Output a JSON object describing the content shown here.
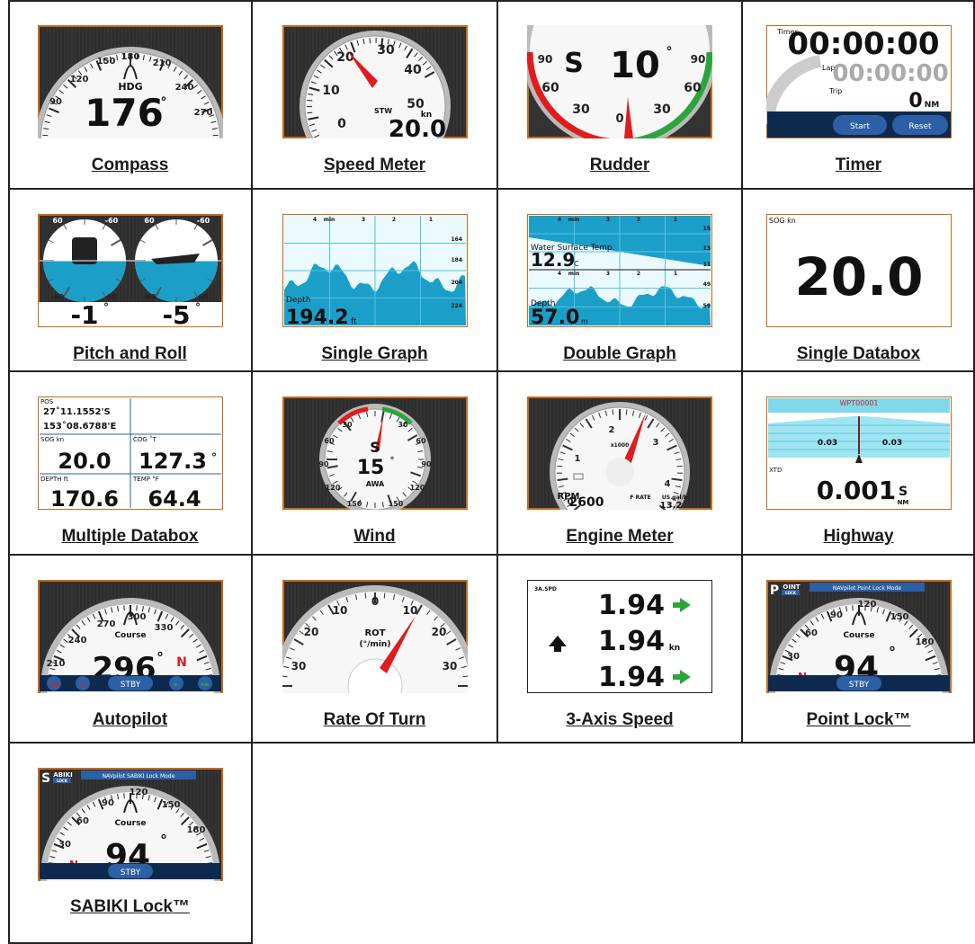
{
  "captions": [
    "Compass",
    "Speed Meter",
    "Rudder",
    "Timer",
    "Pitch and Roll",
    "Single Graph",
    "Double Graph",
    "Single Databox",
    "Multiple Databox",
    "Wind",
    "Engine Meter",
    "Highway",
    "Autopilot",
    "Rate Of Turn",
    "3-Axis Speed",
    "Point Lock™",
    "SABIKI Lock™"
  ],
  "compass": {
    "label": "HDG",
    "value": "176",
    "unit": "°",
    "ticks": [
      "90",
      "120",
      "150",
      "180",
      "210",
      "240",
      "270"
    ]
  },
  "speed": {
    "label": "STW",
    "value": "20.0",
    "unit": "kn",
    "ticks": [
      "0",
      "10",
      "20",
      "30",
      "40",
      "50"
    ]
  },
  "rudder": {
    "side": "S",
    "value": "10",
    "unit": "°",
    "ticks_left": [
      "90",
      "60",
      "30"
    ],
    "ticks_right": [
      "90",
      "60",
      "30"
    ],
    "center": "0"
  },
  "timer": {
    "title": "Timer",
    "time": "00:00:00",
    "lap_label": "Lap",
    "lap": "00:00:00",
    "trip_label": "Trip",
    "trip": "0",
    "trip_unit": "NM",
    "start": "Start",
    "reset": "Reset"
  },
  "pitch_roll": {
    "pitch": "-1",
    "roll": "-5",
    "unit": "°",
    "ticks": [
      "60",
      "-60",
      "-60",
      "60"
    ]
  },
  "single_graph": {
    "label": "Depth",
    "value": "194.2",
    "unit": "ft",
    "time_labels": [
      "4",
      "min",
      "3",
      "2",
      "1"
    ],
    "scale": [
      "164",
      "184",
      "204",
      "224"
    ]
  },
  "double_graph": {
    "top_label": "Water Surface Temp.",
    "top_value": "12.9",
    "top_unit": "°C",
    "top_scale": [
      "15",
      "13",
      "11"
    ],
    "bottom_label": "Depth",
    "bottom_value": "57.0",
    "bottom_unit": "m",
    "bottom_scale": [
      "49",
      "59"
    ],
    "time_labels": [
      "4",
      "min",
      "3",
      "2",
      "1"
    ]
  },
  "single_databox": {
    "label": "SOG kn",
    "value": "20.0"
  },
  "multi_databox": {
    "pos_label": "POS",
    "lat": "27˚11.1552'S",
    "lon": "153˚08.6788'E",
    "sog_label": "SOG kn",
    "sog": "20.0",
    "cog_label": "COG ˚T",
    "cog": "127.3",
    "cog_unit": "°",
    "depth_label": "DEPTH ft",
    "depth": "170.6",
    "temp_label": "TEMP °F",
    "temp": "64.4"
  },
  "wind": {
    "side": "S",
    "value": "15",
    "unit": "°",
    "label": "AWA",
    "ticks": [
      "30",
      "60",
      "90",
      "120",
      "150"
    ]
  },
  "engine": {
    "rpm_label": "RPM",
    "rpm": "2600",
    "scale_label": "x1000",
    "frate_label": "F RATE",
    "frate_unit": "US gal/h",
    "frate": "13.2",
    "ticks": [
      "0",
      "1",
      "2",
      "3",
      "4"
    ]
  },
  "highway": {
    "wpt": "WPT00001",
    "left": "0.03",
    "right": "0.03",
    "xtd_label": "XTD",
    "xtd": "0.001",
    "xtd_side": "S",
    "xtd_unit": "NM"
  },
  "autopilot": {
    "label": "Course",
    "value": "296",
    "unit": "°",
    "side": "N",
    "ticks": [
      "210",
      "240",
      "270",
      "300",
      "330"
    ],
    "stby": "STBY"
  },
  "rot": {
    "label": "ROT",
    "unit": "(°/min)",
    "ticks": [
      "0",
      "10",
      "10",
      "20",
      "20",
      "30",
      "30"
    ]
  },
  "axis3": {
    "title": "3A.SPD",
    "v1": "1.94",
    "v2": "1.94",
    "v2_unit": "kn",
    "v3": "1.94"
  },
  "pointlock": {
    "badge": "P",
    "badge_rest": "OINT",
    "badge_sub": "LOCK",
    "mode": "NAVpilot Point Lock Mode",
    "label": "Course",
    "value": "94",
    "unit": "°",
    "side": "N",
    "ticks": [
      "30",
      "60",
      "90",
      "120",
      "150",
      "180"
    ],
    "stby": "STBY"
  },
  "sabiki": {
    "badge": "S",
    "badge_rest": "ABIKI",
    "badge_sub": "LOCK",
    "mode": "NAVpilot SABIKI Lock Mode",
    "label": "Course",
    "value": "94",
    "unit": "°",
    "side": "N",
    "ticks": [
      "30",
      "60",
      "90",
      "120",
      "150",
      "180"
    ],
    "stby": "STBY"
  },
  "colors": {
    "frame": "#c86a1a",
    "dark_bg": "#333333",
    "blue": "#1b9fc9",
    "navy": "#0d2a4e",
    "red": "#e21b1b",
    "green": "#2aa53b"
  }
}
